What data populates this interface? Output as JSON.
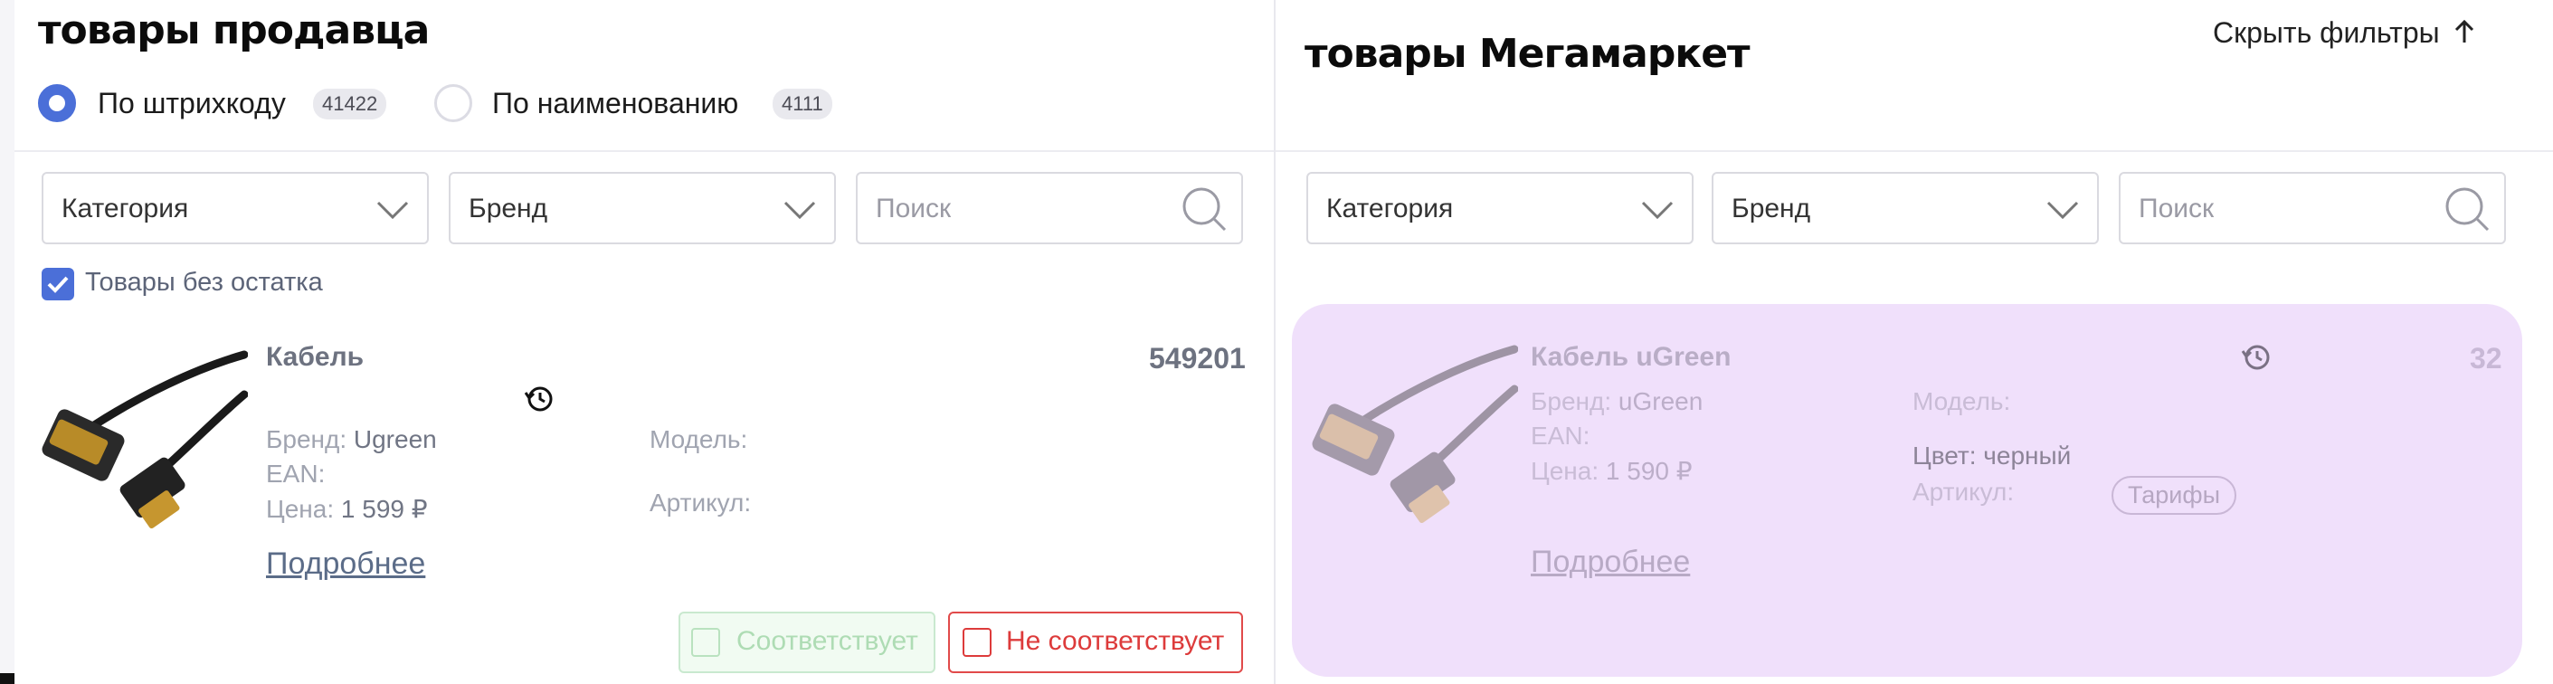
{
  "left": {
    "title": "товары продавца",
    "mode_options": [
      {
        "label": "По штрихкоду",
        "count": "41422",
        "selected": true
      },
      {
        "label": "По наименованию",
        "count": "4111",
        "selected": false
      }
    ],
    "filters": {
      "category": "Категория",
      "brand": "Бренд",
      "search_placeholder": "Поиск"
    },
    "no_stock_checkbox": {
      "label": "Товары без остатка",
      "checked": true
    },
    "product": {
      "name": "Кабель",
      "id": "549201",
      "brand_label": "Бренд:",
      "brand_value": "Ugreen",
      "ean_label": "EAN:",
      "price_label": "Цена:",
      "price_value": "1 599 ₽",
      "model_label": "Модель:",
      "article_label": "Артикул:",
      "details_link": "Подробнее"
    },
    "actions": {
      "match": "Соответствует",
      "no_match": "Не соответствует"
    }
  },
  "right": {
    "title": "товары Мегамаркет",
    "hide_filters": "Скрыть фильтры",
    "filters": {
      "category": "Категория",
      "brand": "Бренд",
      "search_placeholder": "Поиск"
    },
    "product": {
      "name": "Кабель uGreen",
      "count": "32",
      "brand_label": "Бренд:",
      "brand_value": "uGreen",
      "ean_label": "EAN:",
      "price_label": "Цена:",
      "price_value": "1 590 ₽",
      "model_label": "Модель:",
      "color_text": "Цвет: черный",
      "article_label": "Артикул:",
      "tariff_badge": "Тарифы",
      "details_link": "Подробнее"
    }
  },
  "icons": {
    "history": "history-icon",
    "chevron": "chevron-down-icon",
    "search": "search-icon",
    "arrow_up": "arrow-up-icon"
  },
  "colors": {
    "accent": "#4b6fd8",
    "card_bg": "#f0e0fb",
    "danger": "#dd3b3b",
    "success_light": "#aedcb4"
  }
}
